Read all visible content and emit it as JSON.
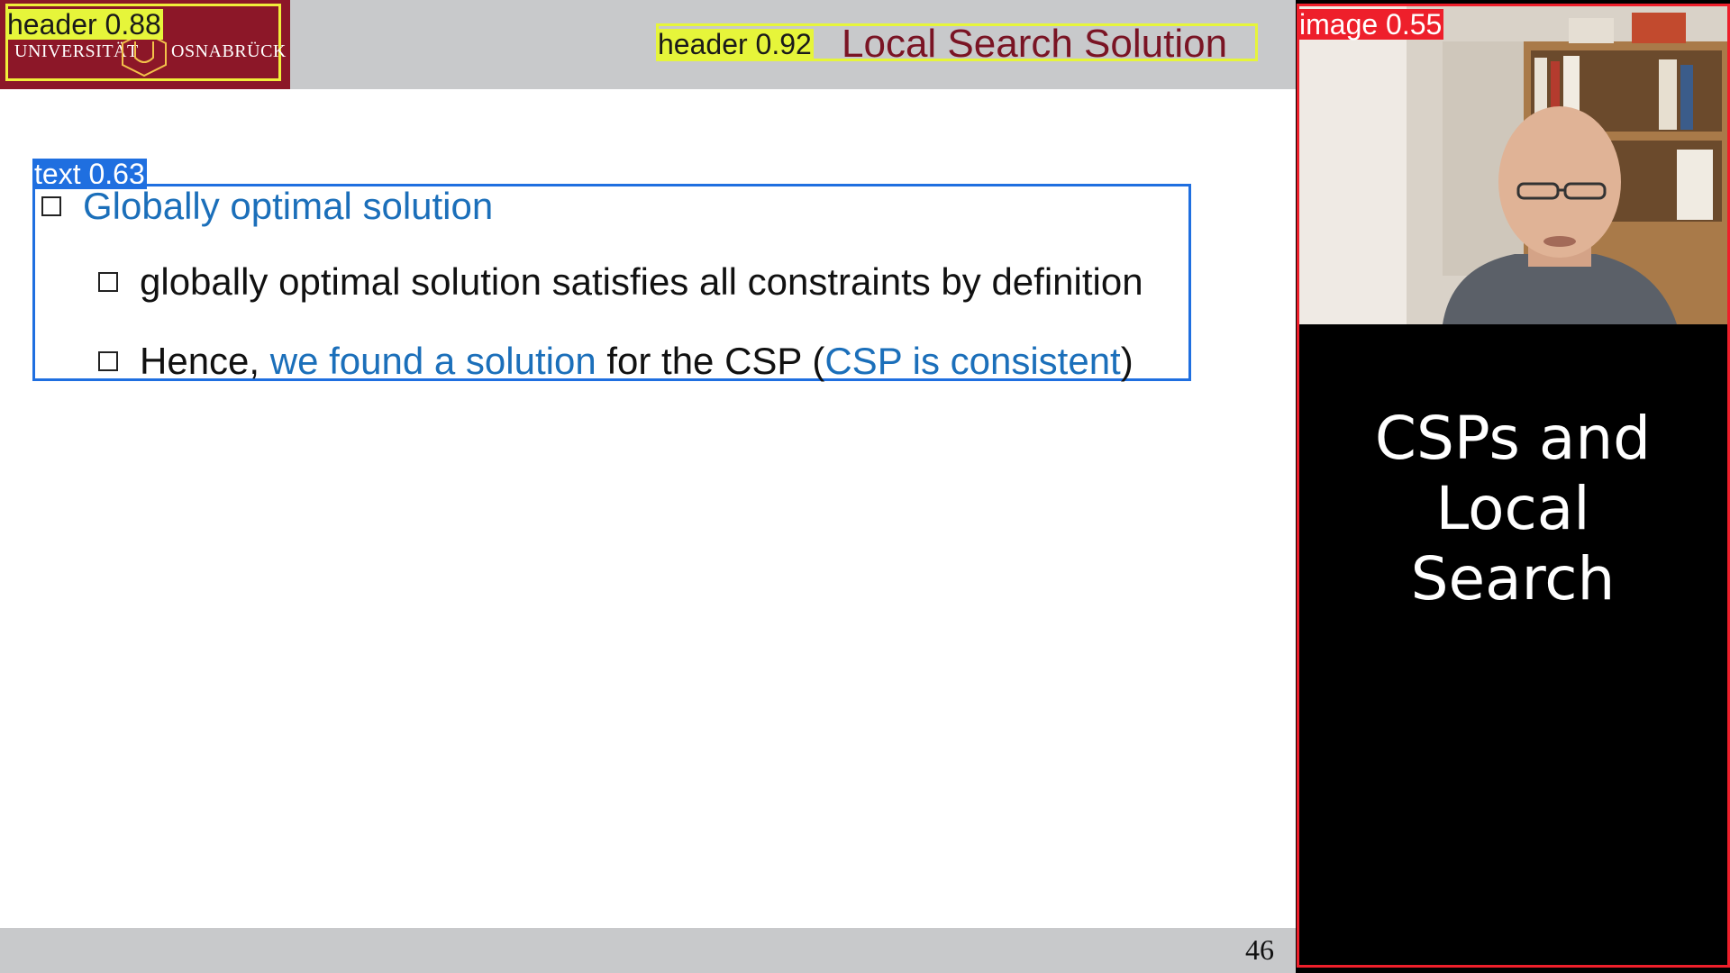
{
  "logo": {
    "left_text": "UNIVERSITÄT",
    "right_text": "OSNABRÜCK",
    "brand_color": "#8c1728"
  },
  "detections": {
    "logo_label": "header 0.88",
    "title_label": "header 0.92",
    "text_label": "text 0.63",
    "image_label": "image 0.55"
  },
  "slide": {
    "title": "Local Search Solution",
    "bullets": [
      {
        "level": 1,
        "parts": [
          {
            "text": "Globally optimal solution",
            "style": "blue"
          }
        ]
      },
      {
        "level": 2,
        "parts": [
          {
            "text": "globally optimal solution satisfies all constraints by definition",
            "style": "plain"
          }
        ]
      },
      {
        "level": 2,
        "parts": [
          {
            "text": "Hence, ",
            "style": "plain"
          },
          {
            "text": "we found a solution",
            "style": "blue"
          },
          {
            "text": " for the CSP (",
            "style": "plain"
          },
          {
            "text": "CSP is consistent",
            "style": "blue"
          },
          {
            "text": ")",
            "style": "plain"
          }
        ]
      }
    ],
    "page_number": "46"
  },
  "webcam": {
    "caption_lines": [
      "CSPs and",
      "Local",
      "Search"
    ]
  },
  "colors": {
    "detection_header": "#e6f53a",
    "detection_text": "#1f6fe0",
    "detection_image": "#ee1f2b",
    "title": "#7a1424",
    "link_blue": "#1b6fba"
  }
}
